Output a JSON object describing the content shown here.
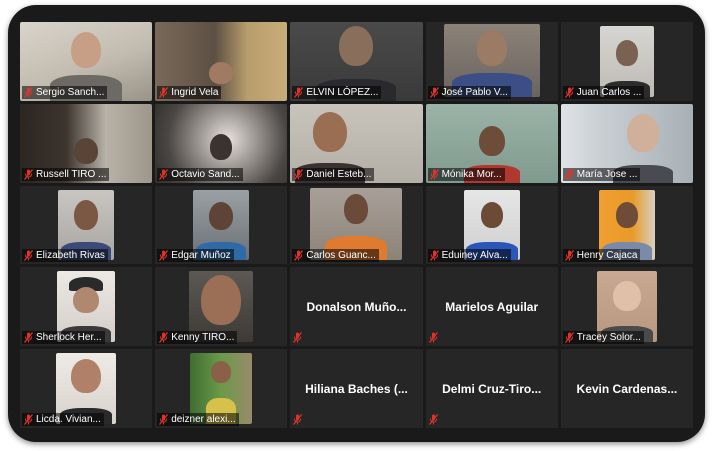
{
  "meeting": {
    "participants": [
      {
        "name": "Sergio Sanch..."
      },
      {
        "name": "Ingrid Vela"
      },
      {
        "name": "ELVIN LÓPEZ..."
      },
      {
        "name": "José Pablo V..."
      },
      {
        "name": "Juan Carlos ..."
      },
      {
        "name": "Russell TIRO ..."
      },
      {
        "name": "Octavio Sand..."
      },
      {
        "name": "Daniel Esteb..."
      },
      {
        "name": "Mónika Mor..."
      },
      {
        "name": "María Jose ..."
      },
      {
        "name": "Elizabeth Rivas"
      },
      {
        "name": "Edgar Muñoz"
      },
      {
        "name": "Carlos Guanc..."
      },
      {
        "name": "Eduiney Alva..."
      },
      {
        "name": "Henry Cajaca"
      },
      {
        "name": "Sherlock Her..."
      },
      {
        "name": "Kenny TIRO..."
      },
      {
        "name": "Donalson Muño..."
      },
      {
        "name": "Marielos Aguilar"
      },
      {
        "name": "Tracey Solor..."
      },
      {
        "name": "Licda. Vivian..."
      },
      {
        "name": "deizner alexi..."
      },
      {
        "name": "Hiliana Baches (..."
      },
      {
        "name": "Delmi Cruz-Tiro..."
      },
      {
        "name": "Kevin Cardenas..."
      }
    ]
  },
  "colors": {
    "mic_muted": "#e0342b",
    "tile_bg": "#262626",
    "frame_bg": "#1a1a1a"
  },
  "icons": {
    "mic": "muted-microphone-icon"
  }
}
